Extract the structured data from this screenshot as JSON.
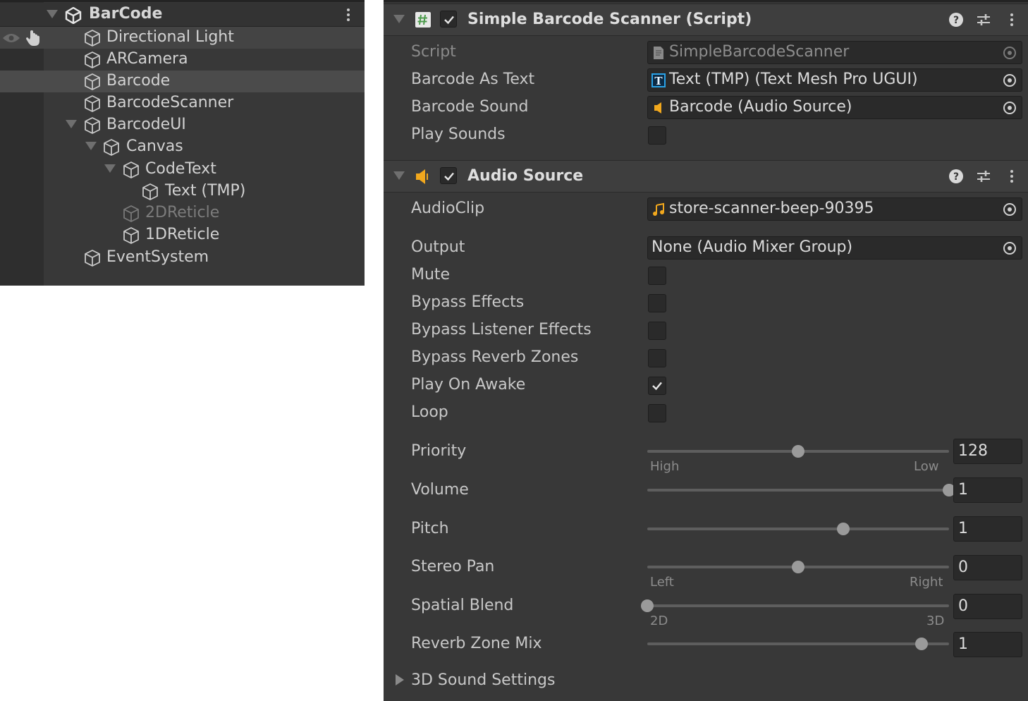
{
  "hierarchy": {
    "scene_name": "BarCode",
    "items": [
      {
        "label": "Directional Light"
      },
      {
        "label": "ARCamera"
      },
      {
        "label": "Barcode"
      },
      {
        "label": "BarcodeScanner"
      },
      {
        "label": "BarcodeUI"
      },
      {
        "label": "Canvas"
      },
      {
        "label": "CodeText"
      },
      {
        "label": "Text (TMP)"
      },
      {
        "label": "2DReticle"
      },
      {
        "label": "1DReticle"
      },
      {
        "label": "EventSystem"
      }
    ]
  },
  "inspector": {
    "script_component": {
      "title": "Simple Barcode Scanner (Script)",
      "enabled": true,
      "script": {
        "label": "Script",
        "value": "SimpleBarcodeScanner"
      },
      "barcode_as_text": {
        "label": "Barcode As Text",
        "value": "Text (TMP) (Text Mesh Pro UGUI)"
      },
      "barcode_sound": {
        "label": "Barcode Sound",
        "value": "Barcode (Audio Source)"
      },
      "play_sounds": {
        "label": "Play Sounds",
        "checked": false
      }
    },
    "audio_source": {
      "title": "Audio Source",
      "enabled": true,
      "audio_clip": {
        "label": "AudioClip",
        "value": "store-scanner-beep-90395"
      },
      "output": {
        "label": "Output",
        "value": "None (Audio Mixer Group)"
      },
      "mute": {
        "label": "Mute",
        "checked": false
      },
      "bypass_effects": {
        "label": "Bypass Effects",
        "checked": false
      },
      "bypass_listener_effects": {
        "label": "Bypass Listener Effects",
        "checked": false
      },
      "bypass_reverb_zones": {
        "label": "Bypass Reverb Zones",
        "checked": false
      },
      "play_on_awake": {
        "label": "Play On Awake",
        "checked": true
      },
      "loop": {
        "label": "Loop",
        "checked": false
      },
      "priority": {
        "label": "Priority",
        "value": "128",
        "fraction": 0.5,
        "min_label": "High",
        "max_label": "Low"
      },
      "volume": {
        "label": "Volume",
        "value": "1",
        "fraction": 1.0
      },
      "pitch": {
        "label": "Pitch",
        "value": "1",
        "fraction": 0.65
      },
      "stereo_pan": {
        "label": "Stereo Pan",
        "value": "0",
        "fraction": 0.5,
        "min_label": "Left",
        "max_label": "Right"
      },
      "spatial_blend": {
        "label": "Spatial Blend",
        "value": "0",
        "fraction": 0.0,
        "min_label": "2D",
        "max_label": "3D"
      },
      "reverb_zone_mix": {
        "label": "Reverb Zone Mix",
        "value": "1",
        "fraction": 0.91
      },
      "sound_settings_3d": {
        "label": "3D Sound Settings"
      }
    }
  },
  "colors": {
    "panel_bg": "#383838",
    "field_bg": "#2a2a2a",
    "text": "#d2d2d2",
    "audio_icon": "#f2a81d",
    "tmp_icon": "#2aa3e8",
    "script_icon": "#6cb86c"
  },
  "icons": {
    "scene": "unity-logo-icon",
    "game_object": "cube-icon",
    "visibility": "eye-icon",
    "pickability": "hand-icon",
    "script": "csharp-script-icon",
    "audio": "speaker-icon",
    "audio_clip": "music-note-icon",
    "tmp": "textmeshpro-icon",
    "object_picker": "target-circle-icon",
    "help": "help-icon",
    "presets": "sliders-icon",
    "menu": "kebab-menu-icon"
  }
}
